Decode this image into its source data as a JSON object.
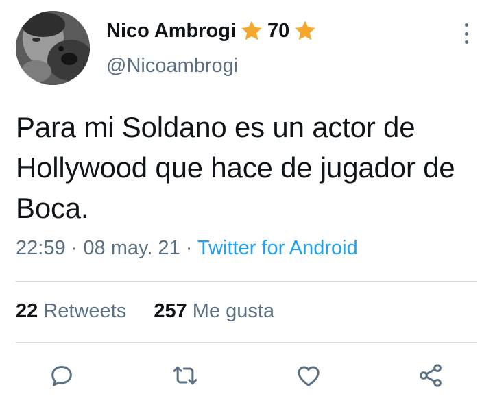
{
  "tweet": {
    "author_name": "Nico Ambrogi",
    "badge_count": "70",
    "handle": "@Nicoambrogi",
    "text": "Para mi Soldano es un actor de Hollywood que hace de jugador de Boca.",
    "time": "22:59",
    "date": "08 may. 21",
    "source": "Twitter for Android",
    "separator": "·"
  },
  "stats": {
    "retweets_count": "22",
    "retweets_label": "Retweets",
    "likes_count": "257",
    "likes_label": "Me gusta"
  },
  "colors": {
    "text": "#0f1419",
    "secondary": "#5b7083",
    "link": "#1da1f2",
    "star": "#f4a72a",
    "divider": "#cfd9de"
  },
  "icons": {
    "more": "more-vertical-icon",
    "reply": "reply-icon",
    "retweet": "retweet-icon",
    "like": "heart-icon",
    "share": "share-icon",
    "star": "star-icon"
  }
}
